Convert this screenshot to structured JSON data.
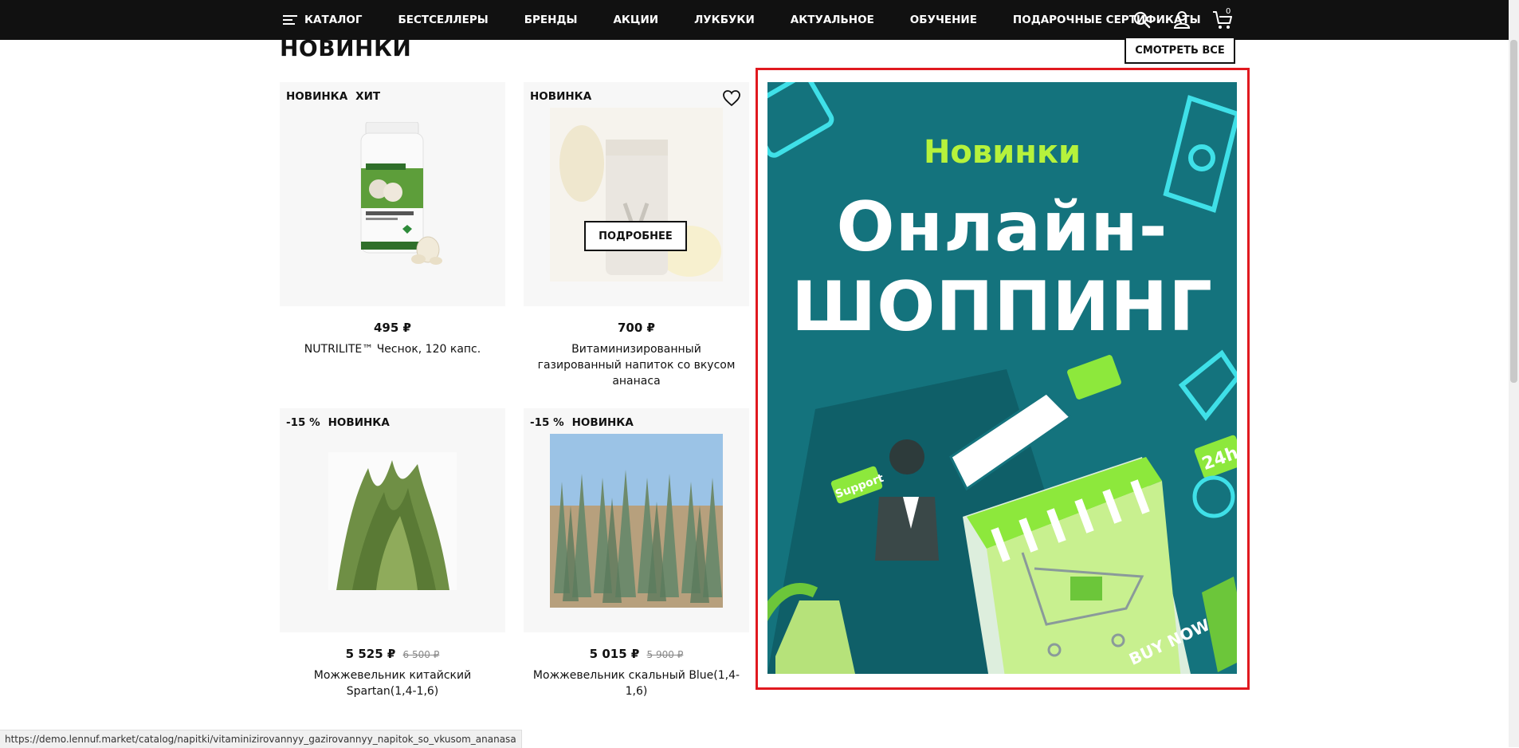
{
  "nav": {
    "catalog": "КАТАЛОГ",
    "items": [
      "БЕСТСЕЛЛЕРЫ",
      "БРЕНДЫ",
      "АКЦИИ",
      "ЛУКБУКИ",
      "АКТУАЛЬНОЕ",
      "ОБУЧЕНИЕ",
      "ПОДАРОЧНЫЕ СЕРТИФИКАТЫ"
    ],
    "cart_count": "0",
    "icons": [
      "search-icon",
      "user-icon",
      "cart-icon"
    ]
  },
  "section": {
    "title": "НОВИНКИ",
    "see_all": "СМОТРЕТЬ ВСЕ"
  },
  "products": [
    {
      "badges": [
        "НОВИНКА",
        "ХИТ"
      ],
      "price": "495 ₽",
      "old_price": "",
      "name": "NUTRILITE™ Чеснок, 120 капс.",
      "image": "garlic-supplement-bottle"
    },
    {
      "badges": [
        "НОВИНКА"
      ],
      "price": "700 ₽",
      "old_price": "",
      "name": "Витаминизированный газированный напиток со вкусом ананаса",
      "image": "pineapple-drink-can",
      "hover_button": "ПОДРОБНЕЕ"
    },
    {
      "badges": [
        "-15 %",
        "НОВИНКА"
      ],
      "price": "5 525 ₽",
      "old_price": "6 500 ₽",
      "name": "Можжевельник китайский Spartan(1,4-1,6)",
      "image": "juniper-shrub"
    },
    {
      "badges": [
        "-15 %",
        "НОВИНКА"
      ],
      "price": "5 015 ₽",
      "old_price": "5 900 ₽",
      "name": "Можжевельник скальный Blue(1,4-1,6)",
      "image": "juniper-nursery-row"
    }
  ],
  "banner": {
    "kicker": "Новинки",
    "headline_line1": "Онлайн-",
    "headline_line2": "ШОППИНГ",
    "badge_support": "Support",
    "badge_24h": "24h",
    "badge_buy": "BUY NOW",
    "colors": {
      "bg": "#14737d",
      "accent": "#b6f23c",
      "frame": "#e0191f"
    }
  },
  "status_url": "https://demo.lennuf.market/catalog/napitki/vitaminizirovannyy_gazirovannyy_napitok_so_vkusom_ananasa"
}
